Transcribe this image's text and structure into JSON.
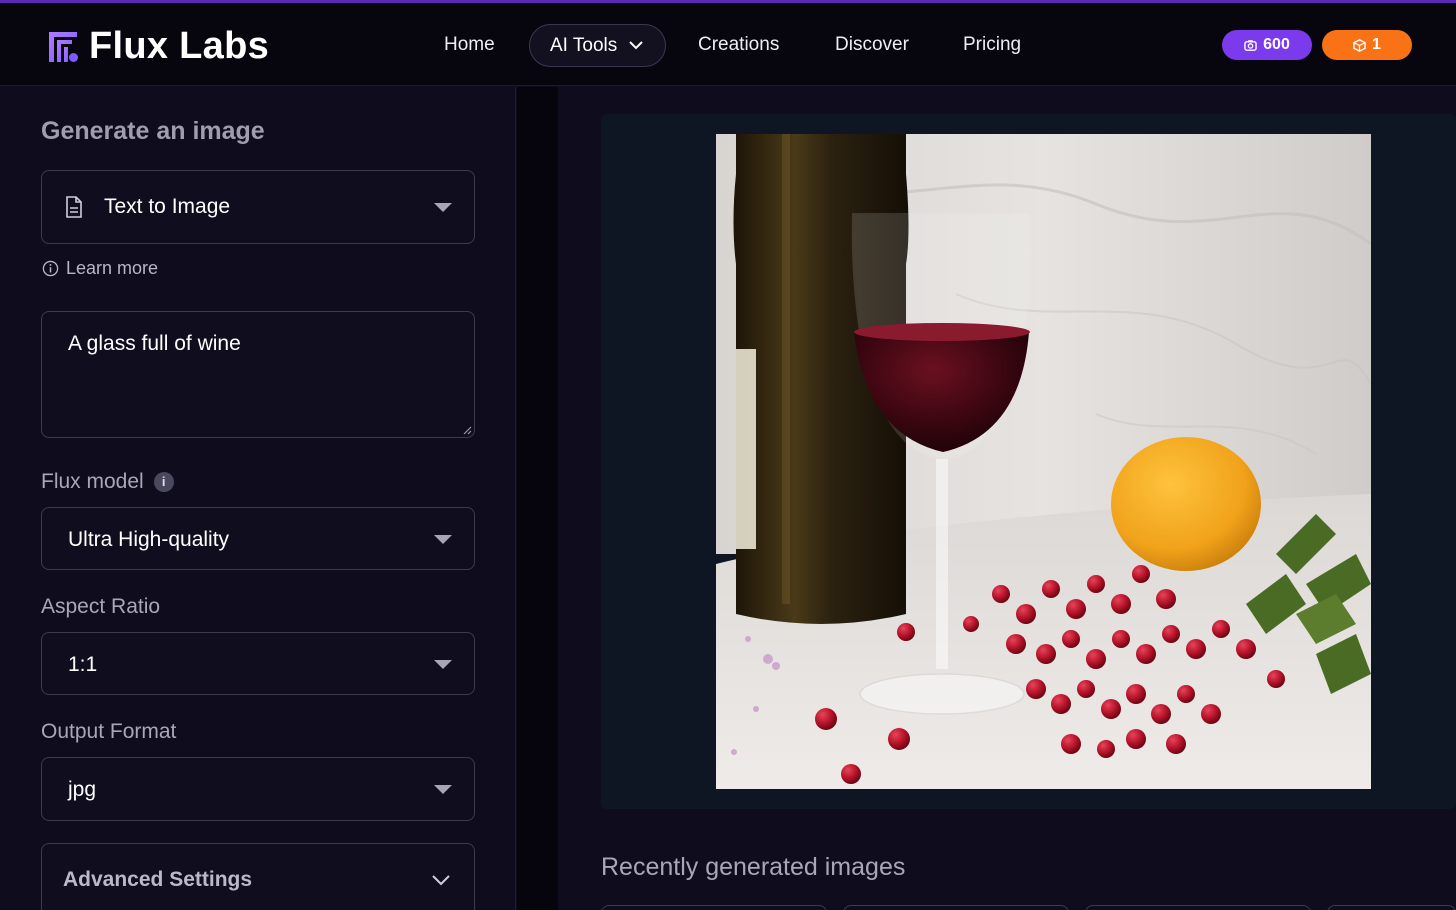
{
  "brand": {
    "name": "Flux Labs"
  },
  "nav": {
    "home": "Home",
    "ai_tools": "AI Tools",
    "creations": "Creations",
    "discover": "Discover",
    "pricing": "Pricing"
  },
  "badges": {
    "credits": "600",
    "gems": "1"
  },
  "sidebar": {
    "title": "Generate an image",
    "mode": "Text to Image",
    "learn_more": "Learn more",
    "prompt": "A glass full of wine",
    "model_label": "Flux model",
    "model_value": "Ultra High-quality",
    "aspect_label": "Aspect Ratio",
    "aspect_value": "1:1",
    "format_label": "Output Format",
    "format_value": "jpg",
    "advanced": "Advanced Settings"
  },
  "main": {
    "recent_title": "Recently generated images"
  },
  "colors": {
    "accent_purple": "#7c3aed",
    "accent_orange": "#f97316",
    "background": "#0f0d1d",
    "header": "#07060f"
  },
  "icons": {
    "logo": "flux-logo-icon",
    "ai_tools_chevron": "chevron-down-icon",
    "credits": "camera-icon",
    "gems": "cube-icon",
    "mode": "document-icon",
    "learn_more": "info-icon",
    "advanced": "chevron-down-icon"
  }
}
